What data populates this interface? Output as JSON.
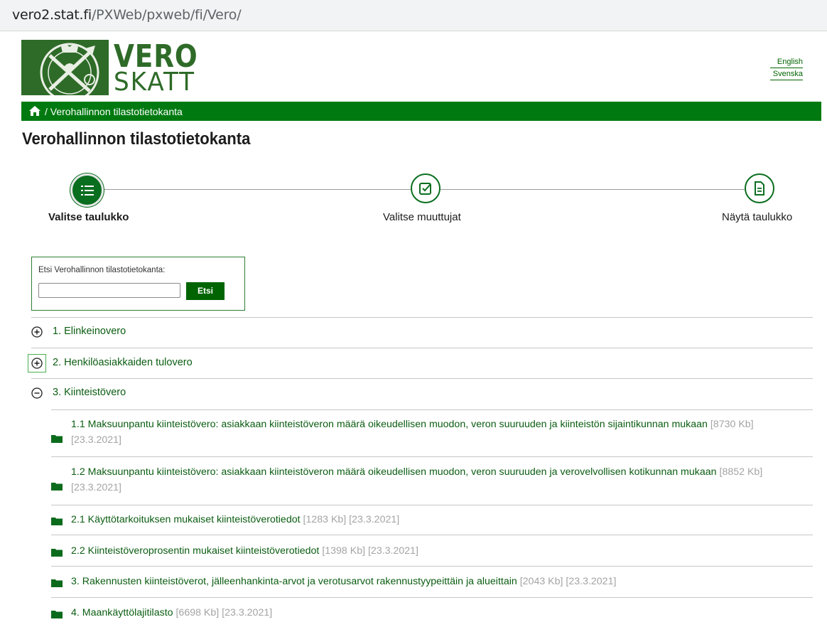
{
  "browser": {
    "url_host": "vero2.stat.fi",
    "url_path": "/PXWeb/pxweb/fi/Vero/"
  },
  "header": {
    "logo_word1": "VERO",
    "logo_word2": "SKATT",
    "languages": [
      "English",
      "Svenska"
    ]
  },
  "breadcrumb": {
    "separator": "/",
    "current": "Verohallinnon tilastotietokanta"
  },
  "page_title": "Verohallinnon tilastotietokanta",
  "steps": [
    {
      "label": "Valitse taulukko",
      "active": true,
      "icon": "list-icon"
    },
    {
      "label": "Valitse muuttujat",
      "active": false,
      "icon": "checkbox-icon"
    },
    {
      "label": "Näytä taulukko",
      "active": false,
      "icon": "document-icon"
    }
  ],
  "search": {
    "label": "Etsi Verohallinnon tilastotietokanta:",
    "value": "",
    "button_label": "Etsi"
  },
  "tree": {
    "nodes": [
      {
        "label": "1. Elinkeinovero",
        "expanded": false
      },
      {
        "label": "2. Henkilöasiakkaiden tulovero",
        "expanded": false
      },
      {
        "label": "3. Kiinteistövero",
        "expanded": true
      }
    ],
    "tables": [
      {
        "title": "1.1 Maksuunpantu kiinteistövero: asiakkaan kiinteistöveron määrä oikeudellisen muodon, veron suuruuden ja kiinteistön sijaintikunnan mukaan",
        "meta": "[8730 Kb] [23.3.2021]"
      },
      {
        "title": "1.2 Maksuunpantu kiinteistövero: asiakkaan kiinteistöveron määrä oikeudellisen muodon, veron suuruuden ja verovelvollisen kotikunnan mukaan",
        "meta": "[8852 Kb] [23.3.2021]"
      },
      {
        "title": "2.1 Käyttötarkoituksen mukaiset kiinteistöverotiedot",
        "meta": "[1283 Kb] [23.3.2021]"
      },
      {
        "title": "2.2 Kiinteistöveroprosentin mukaiset kiinteistöverotiedot",
        "meta": "[1398 Kb] [23.3.2021]"
      },
      {
        "title": "3. Rakennusten kiinteistöverot, jälleenhankinta-arvot ja verotusarvot rakennustyypeittäin ja alueittain",
        "meta": "[2043 Kb] [23.3.2021]"
      },
      {
        "title": "4. Maankäyttölajitilasto",
        "meta": "[6698 Kb] [23.3.2021]"
      }
    ]
  },
  "colors": {
    "brand_green": "#2e6b28",
    "bar_green": "#007a10",
    "link_green": "#0b5d12",
    "meta_gray": "#a4a4a4"
  }
}
